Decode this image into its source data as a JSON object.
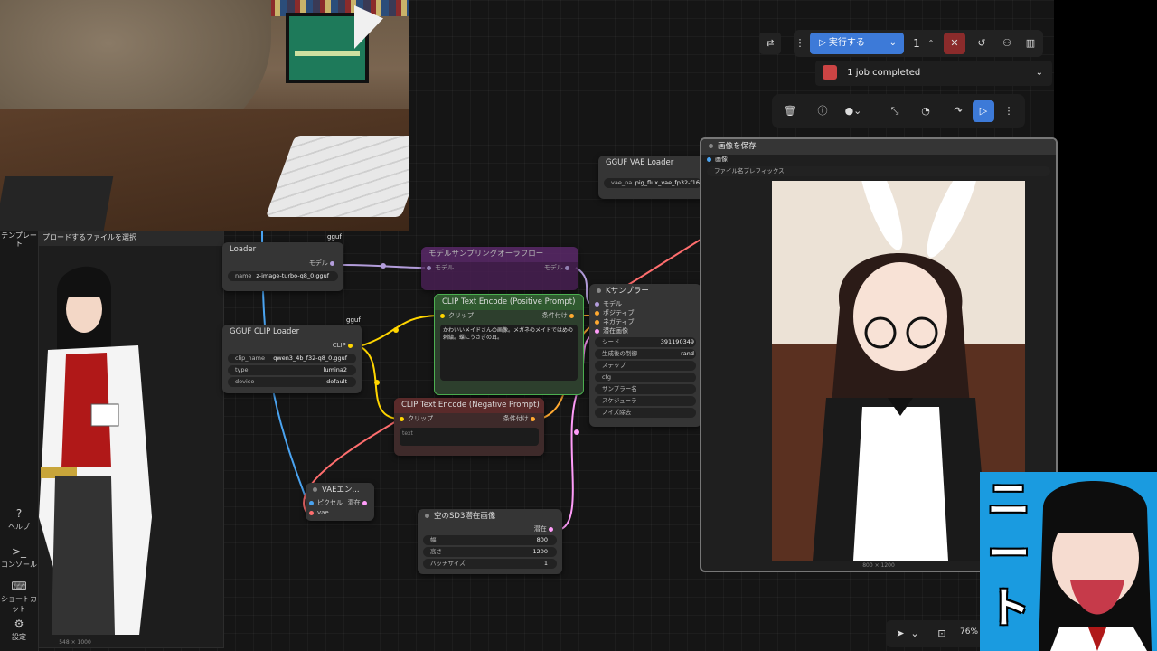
{
  "toolbar": {
    "run_label": "実行する",
    "batch_count": "1"
  },
  "job_status": "1 job completed",
  "zoom": "76%",
  "sidebar": {
    "template_label": "テンプレート",
    "items": [
      {
        "icon": "help-icon",
        "label": "ヘルプ"
      },
      {
        "icon": "console-icon",
        "label": "コンソール"
      },
      {
        "icon": "keyboard-icon",
        "label": "ショートカット"
      },
      {
        "icon": "gear-icon",
        "label": "設定"
      }
    ]
  },
  "load_image": {
    "header": "プロードするファイルを選択",
    "dims": "548 × 1000"
  },
  "unet_loader": {
    "title": "Loader",
    "tag": "gguf",
    "out": "モデル",
    "field_label": "name",
    "field_value": "z-image-turbo-q8_0.gguf"
  },
  "clip_loader": {
    "title": "GGUF CLIP Loader",
    "tag": "gguf",
    "out": "CLIP",
    "fields": [
      {
        "label": "clip_name",
        "value": "qwen3_4b_f32-q8_0.gguf"
      },
      {
        "label": "type",
        "value": "lumina2"
      },
      {
        "label": "device",
        "value": "default"
      }
    ]
  },
  "model_sampling": {
    "title": "モデルサンプリングオーラフロー",
    "in": "モデル",
    "out": "モデル"
  },
  "clip_pos": {
    "title": "CLIP Text Encode (Positive Prompt)",
    "in": "クリップ",
    "out": "条件付け",
    "text": "かわいいメイドさんの画像。メガネのメイドではめの刺繍。蝶にうさぎの耳。"
  },
  "clip_neg": {
    "title": "CLIP Text Encode (Negative Prompt)",
    "in": "クリップ",
    "out": "条件付け",
    "text": "text"
  },
  "vae_loader": {
    "title": "GGUF VAE Loader",
    "field_label": "vae_na...",
    "field_value": "pig_flux_vae_fp32-f16"
  },
  "ksampler": {
    "title": "Kサンプラー",
    "inputs": [
      "モデル",
      "ポジティブ",
      "ネガティブ",
      "潜在画像"
    ],
    "fields": [
      {
        "label": "シード",
        "value": "391190349"
      },
      {
        "label": "生成後の制御",
        "value": "rand"
      },
      {
        "label": "ステップ",
        "value": ""
      },
      {
        "label": "cfg",
        "value": ""
      },
      {
        "label": "サンプラー名",
        "value": ""
      },
      {
        "label": "スケジューラ",
        "value": ""
      },
      {
        "label": "ノイズ除去",
        "value": ""
      }
    ]
  },
  "vae_encode": {
    "title": "VAEエン...",
    "in1": "ピクセル",
    "in2": "vae",
    "out": "潜在"
  },
  "empty_latent": {
    "title": "空のSD3潜在画像",
    "out": "潜在",
    "fields": [
      {
        "label": "幅",
        "value": "800"
      },
      {
        "label": "高さ",
        "value": "1200"
      },
      {
        "label": "バッチサイズ",
        "value": "1"
      }
    ]
  },
  "save_image": {
    "title": "画像を保存",
    "in": "画像",
    "prefix": "ファイル名プレフィックス",
    "dims": "800 × 1200"
  },
  "overlay": {
    "neet_text": "ニート"
  },
  "colors": {
    "run_button": "#3d7ad8",
    "accent_green": "#4caf50",
    "wire_model": "#b39ddb",
    "wire_clip": "#ffd500",
    "wire_cond": "#ffa931",
    "wire_latent": "#ff9cf9",
    "wire_vae": "#ff6e6e"
  }
}
